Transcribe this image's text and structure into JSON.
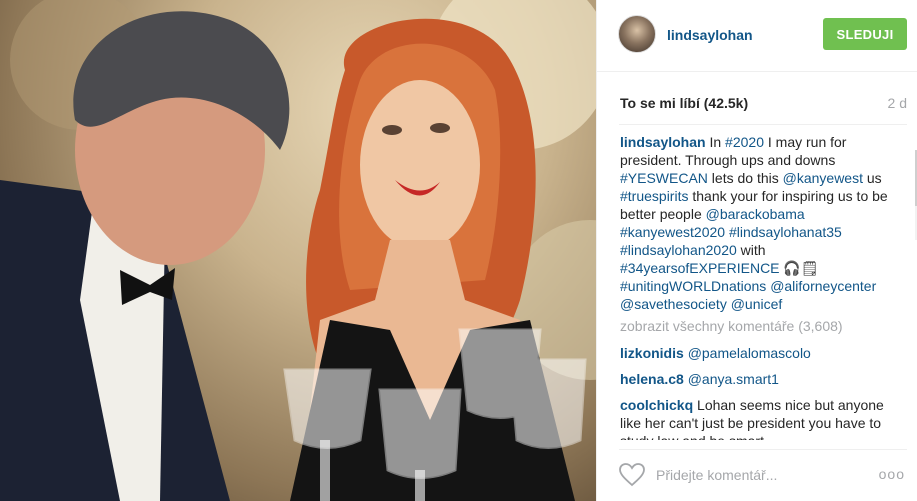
{
  "post": {
    "username": "lindsaylohan",
    "follow_label": "SLEDUJI",
    "likes_label": "To se mi líbí (42.5k)",
    "time_ago": "2 d"
  },
  "caption": {
    "username": "lindsaylohan",
    "parts": [
      {
        "t": "In ",
        "tag": false
      },
      {
        "t": "#2020",
        "tag": true
      },
      {
        "t": " I may run for president. Through ups and downs ",
        "tag": false
      },
      {
        "t": "#YESWECAN",
        "tag": true
      },
      {
        "t": " lets do this ",
        "tag": false
      },
      {
        "t": "@kanyewest",
        "tag": true
      },
      {
        "t": " us ",
        "tag": false
      },
      {
        "t": "#truespirits",
        "tag": true
      },
      {
        "t": " thank your for inspiring us to be better people ",
        "tag": false
      },
      {
        "t": "@barackobama",
        "tag": true
      },
      {
        "t": " ",
        "tag": false
      },
      {
        "t": "#kanyewest2020",
        "tag": true
      },
      {
        "t": " ",
        "tag": false
      },
      {
        "t": "#lindsaylohanat35",
        "tag": true
      },
      {
        "t": " ",
        "tag": false
      },
      {
        "t": "#lindsaylohan2020",
        "tag": true
      },
      {
        "t": " with ",
        "tag": false
      },
      {
        "t": "#34yearsofEXPERIENCE",
        "tag": true
      },
      {
        "t": " 🎧🗒 ",
        "tag": false
      },
      {
        "t": "#unitingWORLDnations",
        "tag": true
      },
      {
        "t": " ",
        "tag": false
      },
      {
        "t": "@aliforneycenter",
        "tag": true
      },
      {
        "t": " ",
        "tag": false
      },
      {
        "t": "@savethesociety",
        "tag": true
      },
      {
        "t": " ",
        "tag": false
      },
      {
        "t": "@unicef",
        "tag": true
      }
    ]
  },
  "view_all_label": "zobrazit všechny komentáře (3,608)",
  "comments": [
    {
      "username": "lizkonidis",
      "parts": [
        {
          "t": "@pamelalomascolo",
          "tag": true
        }
      ]
    },
    {
      "username": "helena.c8",
      "parts": [
        {
          "t": "@anya.smart1",
          "tag": true
        }
      ]
    },
    {
      "username": "coolchickq",
      "parts": [
        {
          "t": "Lohan seems nice but anyone like her can't just be president you have to study law and be smart",
          "tag": false
        }
      ]
    }
  ],
  "footer": {
    "comment_placeholder": "Přidejte komentář...",
    "more_label": "ooo",
    "like_icon": "heart-outline-icon"
  },
  "colors": {
    "link": "#125688",
    "follow_button": "#70c050",
    "muted": "#a5a7aa"
  }
}
